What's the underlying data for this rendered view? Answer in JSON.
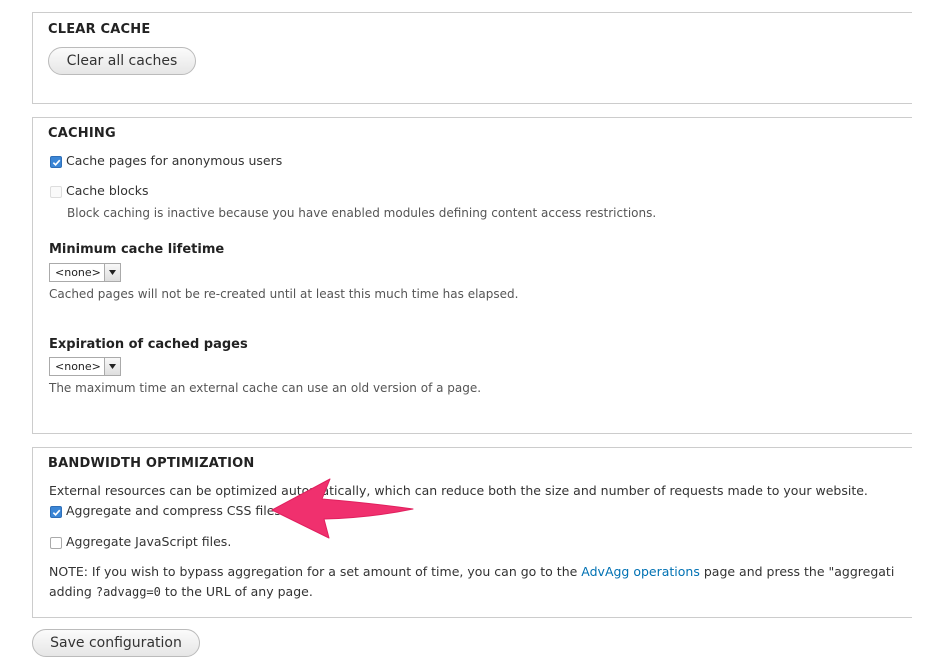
{
  "clear_cache": {
    "legend": "CLEAR CACHE",
    "button_label": "Clear all caches"
  },
  "caching": {
    "legend": "CACHING",
    "anonymous": {
      "label": "Cache pages for anonymous users",
      "checked": true
    },
    "blocks": {
      "label": "Cache blocks",
      "checked": false,
      "description": "Block caching is inactive because you have enabled modules defining content access restrictions."
    },
    "min_lifetime": {
      "label": "Minimum cache lifetime",
      "value": "<none>",
      "description": "Cached pages will not be re-created until at least this much time has elapsed."
    },
    "expiration": {
      "label": "Expiration of cached pages",
      "value": "<none>",
      "description": "The maximum time an external cache can use an old version of a page."
    }
  },
  "bandwidth": {
    "legend": "BANDWIDTH OPTIMIZATION",
    "intro": "External resources can be optimized automatically, which can reduce both the size and number of requests made to your website.",
    "css": {
      "label": "Aggregate and compress CSS files.",
      "checked": true
    },
    "js": {
      "label": "Aggregate JavaScript files.",
      "checked": false
    },
    "note_prefix": "NOTE: If you wish to bypass aggregation for a set amount of time, you can go to the ",
    "note_link": "AdvAgg operations",
    "note_suffix": " page and press the \"aggregati",
    "note_line2_prefix": "adding ",
    "note_code": "?advagg=0",
    "note_line2_suffix": " to the URL of any page."
  },
  "save_button_label": "Save configuration",
  "colors": {
    "arrow": "#f0306e",
    "checkbox_checked": "#3b86d6",
    "link": "#0071b3"
  },
  "icons": {
    "checkmark": "checkmark-icon",
    "select_arrow": "triangle-down-icon",
    "annotation": "pointing-arrow-icon"
  }
}
